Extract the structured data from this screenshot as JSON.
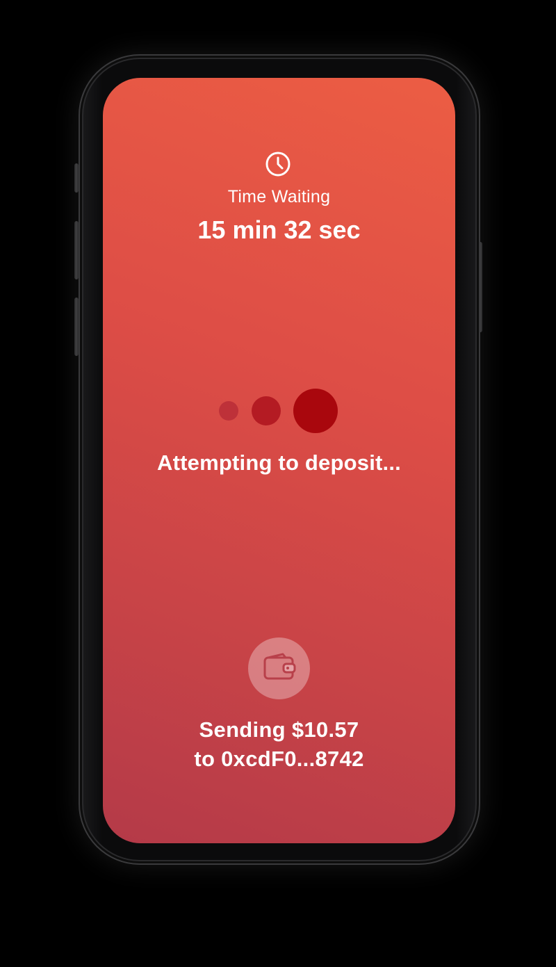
{
  "timer": {
    "icon": "clock-icon",
    "label": "Time Waiting",
    "value": "15 min 32 sec"
  },
  "progress": {
    "dots_color": "#a9070d",
    "status": "Attempting to deposit..."
  },
  "transaction": {
    "icon": "wallet-icon",
    "line1": "Sending $10.57",
    "line2": "to 0xcdF0...8742"
  },
  "colors": {
    "screen_gradient_top": "#ec5d44",
    "screen_gradient_bottom": "#b43a48",
    "text": "#ffffff"
  }
}
